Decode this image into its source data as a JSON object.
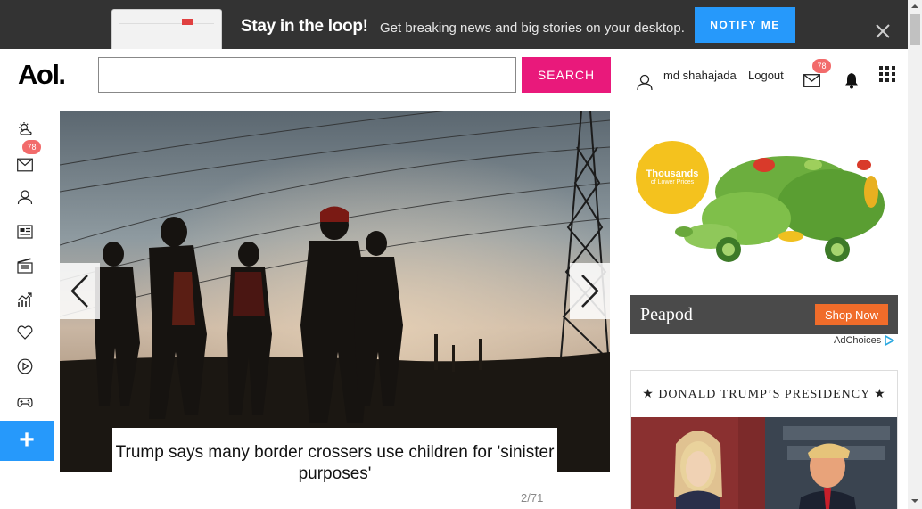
{
  "banner": {
    "title": "Stay in the loop!",
    "subtitle": "Get breaking news and big stories on your desktop.",
    "notify_label": "NOTIFY ME"
  },
  "header": {
    "logo": "Aol.",
    "search_value": "",
    "search_label": "SEARCH",
    "username": "md shahajada",
    "logout_label": "Logout",
    "mail_count": "78"
  },
  "rail": {
    "mail_count": "78",
    "icons": [
      "weather-icon",
      "mail-icon",
      "profile-icon",
      "news-icon",
      "entertainment-icon",
      "finance-icon",
      "lifestyle-icon",
      "video-icon",
      "games-icon"
    ],
    "plus_label": "+"
  },
  "hero": {
    "caption": "Trump says many border crossers use children for 'sinister purposes'",
    "slide_count": "2/71"
  },
  "ad": {
    "badge_line1": "Thousands",
    "badge_line2": "of Lower Prices",
    "brand": "Peapod",
    "cta": "Shop Now",
    "adchoices": "AdChoices"
  },
  "panel": {
    "title": "★ DONALD TRUMP’S PRESIDENCY ★"
  },
  "colors": {
    "banner_bg": "#333333",
    "notify_blue": "#2699fb",
    "search_pink": "#e9197b",
    "badge_red": "#f26b6b",
    "shop_orange": "#f06c2a"
  }
}
